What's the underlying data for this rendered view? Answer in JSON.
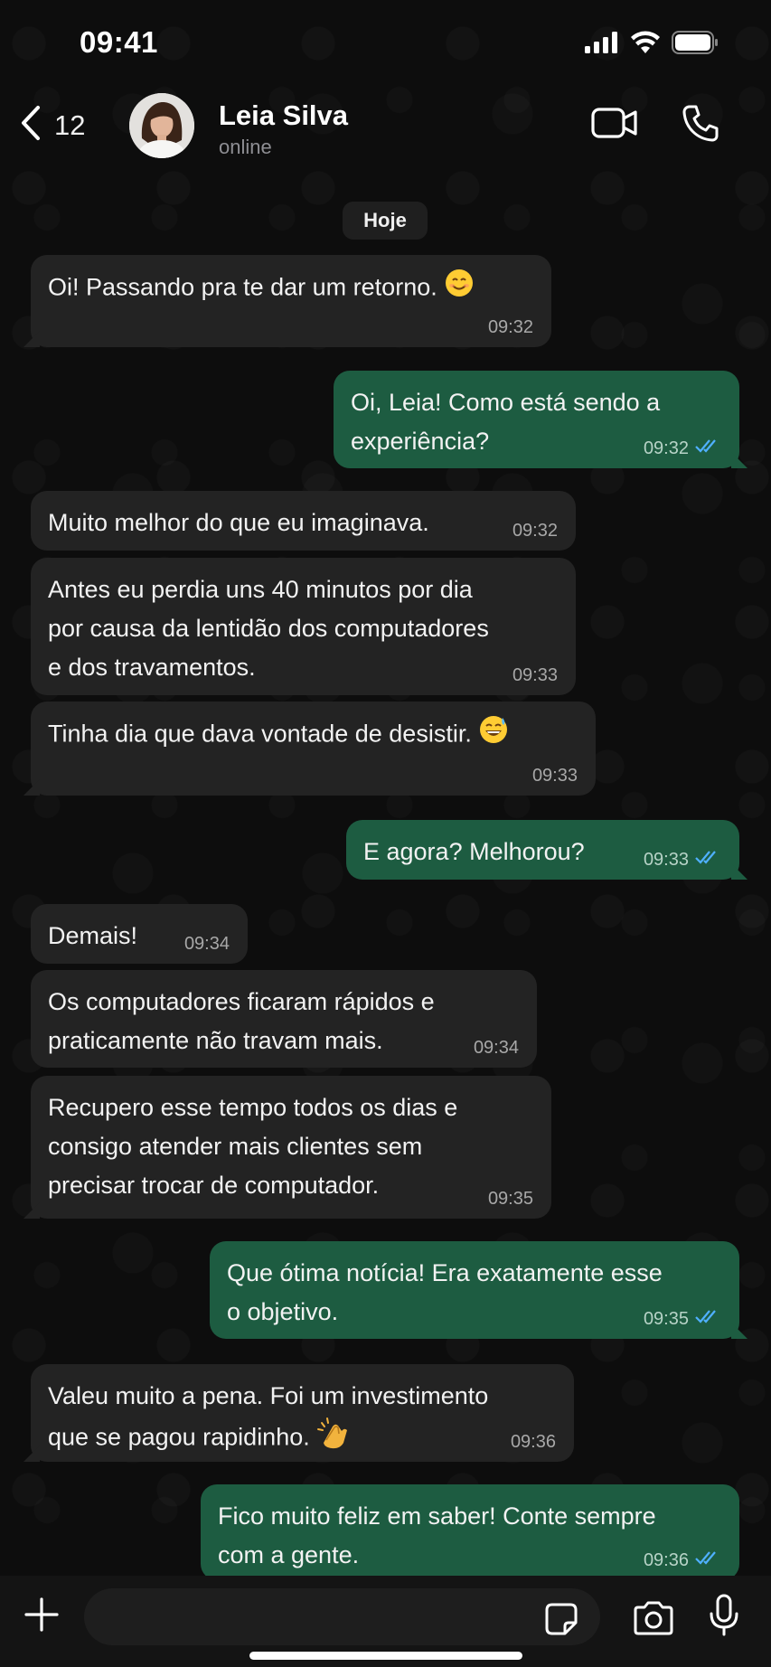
{
  "status_bar": {
    "time": "09:41"
  },
  "header": {
    "back_count": "12",
    "contact_name": "Leia Silva",
    "contact_status": "online"
  },
  "date_chip": "Hoje",
  "messages": [
    {
      "direction": "in",
      "text": "Oi! Passando pra te dar um retorno.",
      "emoji": "smiling-face",
      "time": "09:32"
    },
    {
      "direction": "out",
      "text": "Oi, Leia! Como está sendo a\nexperiência?",
      "time": "09:32",
      "read": true
    },
    {
      "direction": "in",
      "text": "Muito melhor do que eu imaginava.",
      "time": "09:32"
    },
    {
      "direction": "in",
      "text": "Antes eu perdia uns 40 minutos por dia\npor causa da lentidão dos computadores\ne dos travamentos.",
      "time": "09:33"
    },
    {
      "direction": "in",
      "text": "Tinha dia que dava vontade de desistir.",
      "emoji": "grinning-sweat-face",
      "time": "09:33"
    },
    {
      "direction": "out",
      "text": "E agora? Melhorou?",
      "time": "09:33",
      "read": true
    },
    {
      "direction": "in",
      "text": "Demais!",
      "time": "09:34"
    },
    {
      "direction": "in",
      "text": "Os computadores ficaram rápidos e\npraticamente não travam mais.",
      "time": "09:34"
    },
    {
      "direction": "in",
      "text": "Recupero esse tempo todos os dias e\nconsigo atender mais clientes sem\nprecisar trocar de computador.",
      "time": "09:35"
    },
    {
      "direction": "out",
      "text": "Que ótima notícia! Era exatamente esse\no objetivo.",
      "time": "09:35",
      "read": true
    },
    {
      "direction": "in",
      "text": "Valeu muito a pena. Foi um investimento\nque se pagou rapidinho.",
      "emoji": "clapping-hands",
      "time": "09:36"
    },
    {
      "direction": "out",
      "text": "Fico muito feliz em saber! Conte sempre\ncom a gente.",
      "time": "09:36",
      "read": true
    }
  ],
  "colors": {
    "incoming_bubble": "#232323",
    "outgoing_bubble": "#1d5c41",
    "read_ticks": "#4fb0ff",
    "background": "#0b0b0b"
  },
  "icons": [
    "chevron-left-icon",
    "video-icon",
    "phone-icon",
    "plus-icon",
    "sticker-icon",
    "camera-icon",
    "mic-icon",
    "signal-icon",
    "wifi-icon",
    "battery-icon"
  ]
}
